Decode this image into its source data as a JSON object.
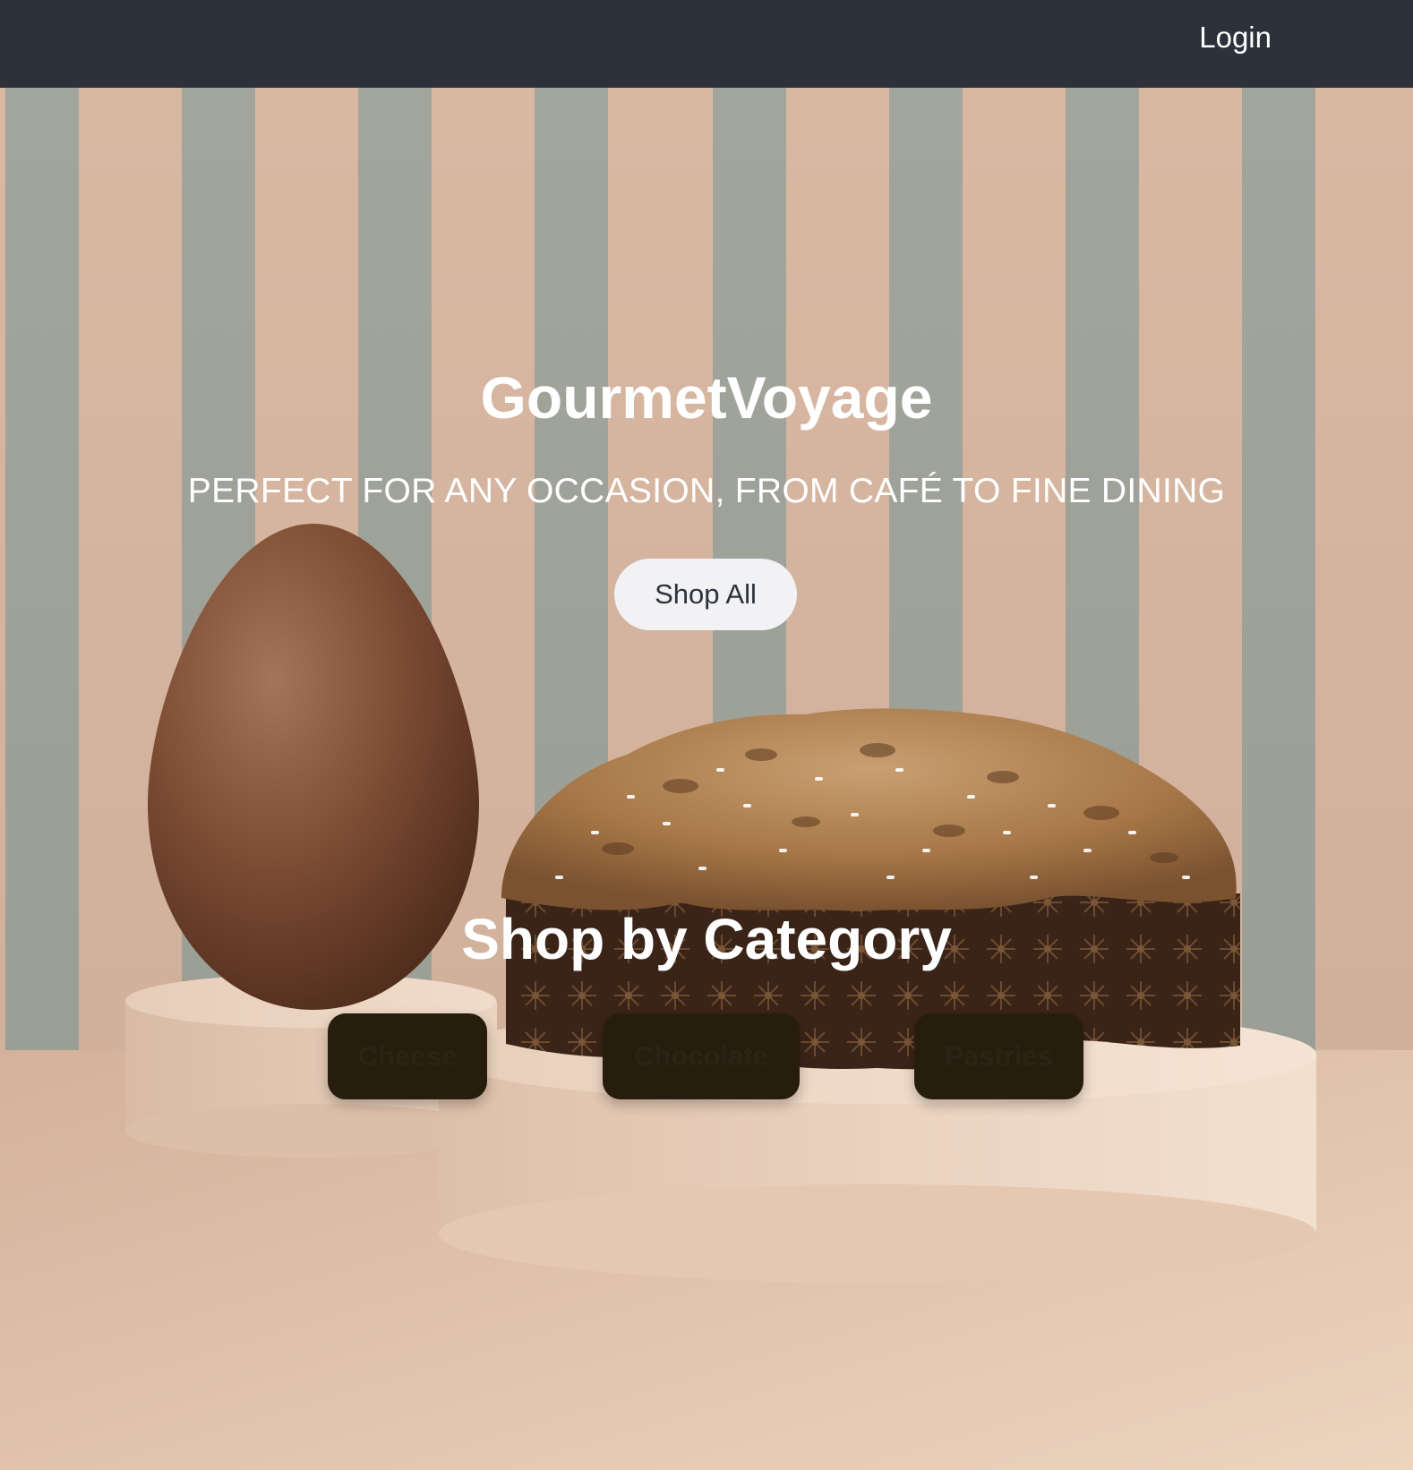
{
  "navbar": {
    "login_label": "Login"
  },
  "hero": {
    "title": "GourmetVoyage",
    "tagline": "PERFECT FOR ANY OCCASION, FROM CAFÉ TO FINE DINING",
    "cta_label": "Shop All",
    "image": "easter-egg-and-colomba-cake"
  },
  "categories": {
    "heading": "Shop by Category",
    "items": [
      {
        "label": "Cheese"
      },
      {
        "label": "Chocolate"
      },
      {
        "label": "Pastries"
      }
    ]
  },
  "colors": {
    "navbar_bg": "#2d313b",
    "button_light": "#f2f2f5",
    "category_button_bg": "#261d0c",
    "stripe_pink": "#d9b8a2",
    "stripe_grey": "#a1a59c"
  }
}
